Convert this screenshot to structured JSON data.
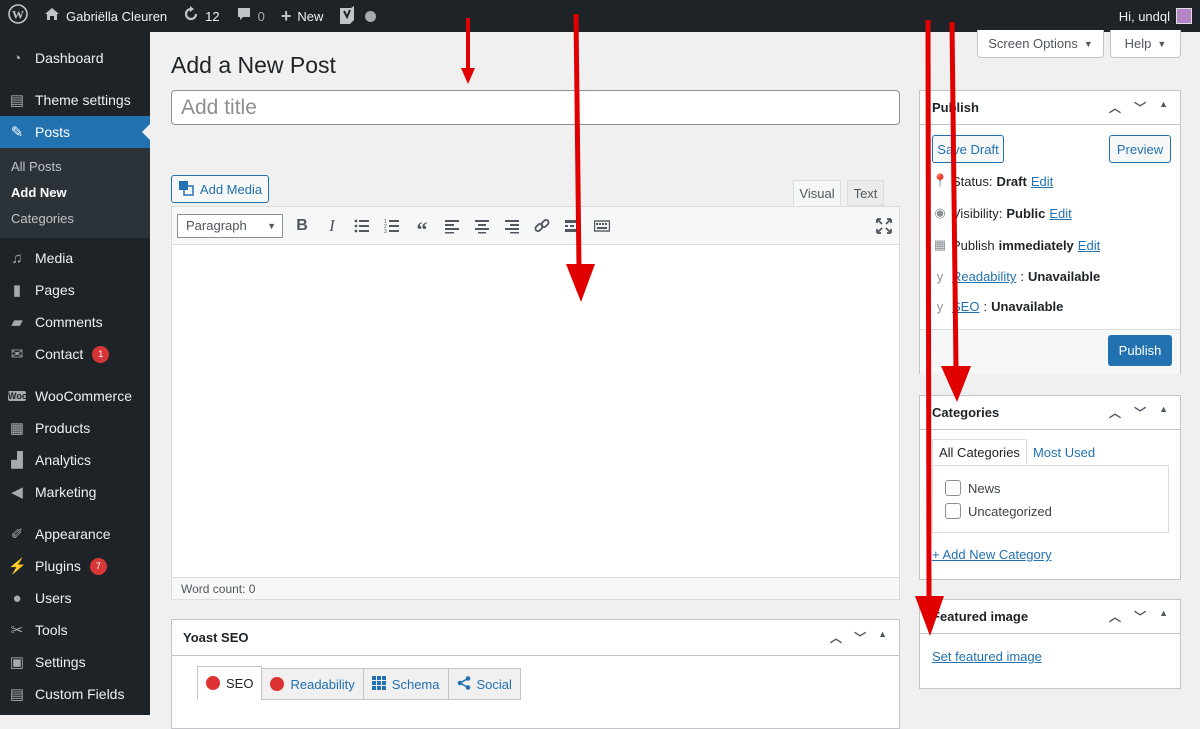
{
  "adminbar": {
    "site_name": "Gabriëlla Cleuren",
    "updates_count": "12",
    "comments_count": "0",
    "new_label": "New",
    "greeting": "Hi, undql"
  },
  "sidebar": {
    "items": [
      {
        "label": "Dashboard",
        "icon": "dashboard-icon"
      },
      {
        "label": "Theme settings",
        "icon": "theme-settings-icon"
      },
      {
        "label": "Posts",
        "icon": "pin-icon"
      },
      {
        "label": "Media",
        "icon": "media-icon"
      },
      {
        "label": "Pages",
        "icon": "pages-icon"
      },
      {
        "label": "Comments",
        "icon": "comments-icon"
      },
      {
        "label": "Contact",
        "icon": "mail-icon",
        "badge": "1"
      },
      {
        "label": "WooCommerce",
        "icon": "woo-icon"
      },
      {
        "label": "Products",
        "icon": "products-icon"
      },
      {
        "label": "Analytics",
        "icon": "analytics-icon"
      },
      {
        "label": "Marketing",
        "icon": "megaphone-icon"
      },
      {
        "label": "Appearance",
        "icon": "brush-icon"
      },
      {
        "label": "Plugins",
        "icon": "plug-icon",
        "badge": "7"
      },
      {
        "label": "Users",
        "icon": "user-icon"
      },
      {
        "label": "Tools",
        "icon": "wrench-icon"
      },
      {
        "label": "Settings",
        "icon": "settings-icon"
      },
      {
        "label": "Custom Fields",
        "icon": "fields-icon"
      }
    ],
    "posts_submenu": [
      "All Posts",
      "Add New",
      "Categories"
    ]
  },
  "header": {
    "screen_options": "Screen Options",
    "help": "Help"
  },
  "main": {
    "page_title": "Add a New Post",
    "title_placeholder": "Add title",
    "add_media": "Add Media",
    "tab_visual": "Visual",
    "tab_text": "Text",
    "format_select": "Paragraph",
    "word_count": "Word count: 0"
  },
  "yoast": {
    "title": "Yoast SEO",
    "tabs": [
      "SEO",
      "Readability",
      "Schema",
      "Social"
    ]
  },
  "publish": {
    "title": "Publish",
    "save_draft": "Save Draft",
    "preview": "Preview",
    "status_label": "Status:",
    "status_value": "Draft",
    "visibility_label": "Visibility:",
    "visibility_value": "Public",
    "publish_label": "Publish",
    "publish_value": "immediately",
    "edit": "Edit",
    "readability_link": "Readability",
    "readability_value": "Unavailable",
    "seo_link": "SEO",
    "seo_value": "Unavailable",
    "publish_button": "Publish"
  },
  "categories": {
    "title": "Categories",
    "tab_all": "All Categories",
    "tab_most_used": "Most Used",
    "items": [
      "News",
      "Uncategorized"
    ],
    "add_new": "+ Add New Category"
  },
  "featured": {
    "title": "Featured image",
    "set_link": "Set featured image"
  },
  "colors": {
    "admin_dark": "#1d2327",
    "accent_blue": "#2271b1",
    "arrow_red": "#e00000",
    "badge_red": "#d63638"
  }
}
